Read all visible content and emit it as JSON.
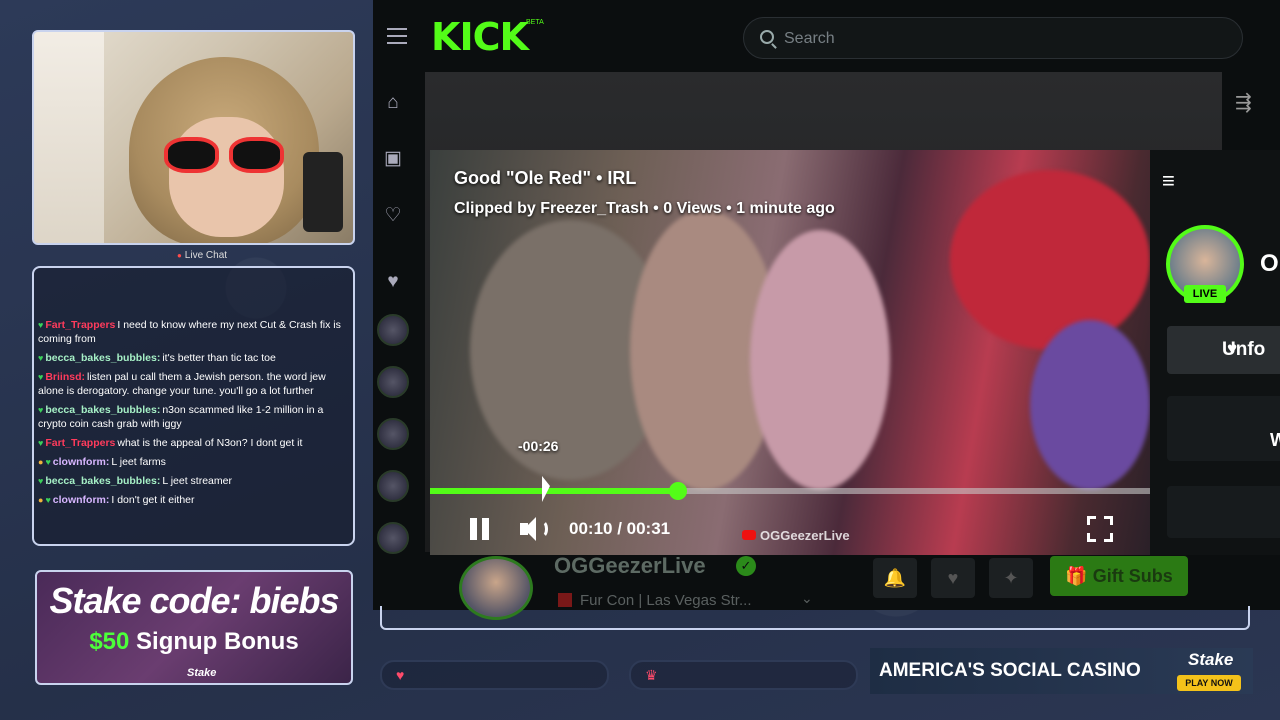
{
  "overlay": {
    "live_chat_label": "Live Chat",
    "stake_ad": {
      "line1": "Stake code: biebs",
      "line2_amount": "$50",
      "line2_text": " Signup Bonus",
      "logo": "Stake"
    },
    "casino_banner": {
      "text": "AMERICA'S SOCIAL CASINO",
      "logo": "Stake",
      "cta": "PLAY NOW"
    }
  },
  "chat": [
    {
      "user": "Fart_Trappers",
      "color": "#ff3b5c",
      "message": "I need to know where my next Cut & Crash fix is coming from",
      "mod": false
    },
    {
      "user": "becca_bakes_bubbles:",
      "color": "#a6f0c6",
      "message": "it's better than tic tac toe",
      "mod": false
    },
    {
      "user": "Briinsd:",
      "color": "#ff3b5c",
      "message": "listen pal u call them a Jewish person. the word jew alone is derogatory. change your tune. you'll go a lot further",
      "mod": false
    },
    {
      "user": "becca_bakes_bubbles:",
      "color": "#a6f0c6",
      "message": "n3on scammed like 1-2 million in a crypto coin cash grab with iggy",
      "mod": false
    },
    {
      "user": "Fart_Trappers",
      "color": "#ff3b5c",
      "message": "what is the appeal of N3on? I dont get it",
      "mod": false
    },
    {
      "user": "clownform:",
      "color": "#d7b6ff",
      "message": "L jeet farms",
      "mod": true
    },
    {
      "user": "becca_bakes_bubbles:",
      "color": "#a6f0c6",
      "message": "L jeet streamer",
      "mod": false
    },
    {
      "user": "clownform:",
      "color": "#d7b6ff",
      "message": "I don't get it either",
      "mod": true
    }
  ],
  "kick": {
    "logo": "KICK",
    "beta": "BETA",
    "search_placeholder": "Search",
    "nav_icons": [
      "home-icon",
      "browse-icon",
      "following-icon",
      "heart-icon"
    ],
    "channel": {
      "name": "OGGeezerLive",
      "title": "Fur Con | Las Vegas Str...",
      "gift_label": "Gift Subs"
    },
    "right_panel": {
      "live_badge": "LIVE",
      "name_partial": "O",
      "unfollow_partial": "Unfo",
      "wa_partial": "Wa"
    }
  },
  "clip": {
    "title": "Good \"Ole Red\" • IRL",
    "subtitle": "Clipped by Freezer_Trash • 0 Views • 1 minute ago",
    "scrub_tooltip": "-00:26",
    "time": "00:10 / 00:31",
    "progress": 0.345,
    "hover_position": 0.16,
    "watermark": "OGGeezerLive"
  },
  "colors": {
    "accent": "#53fc18",
    "live_dot": "#ff4b4b"
  }
}
